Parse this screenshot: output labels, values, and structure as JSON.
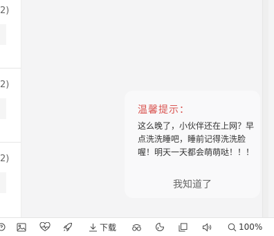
{
  "left_list": {
    "items": [
      {
        "paren": "2)"
      },
      {
        "paren": "2)"
      },
      {
        "paren": "2)"
      }
    ]
  },
  "notice": {
    "title": "温馨提示：",
    "message": "这么晚了，小伙伴还在上网？早点洗洗睡吧，睡前记得洗洗脸喔！明天一天都会萌萌哒！！！",
    "button_label": "我知道了"
  },
  "toolbar": {
    "items": [
      {
        "icon": "help-icon"
      },
      {
        "icon": "image-icon"
      },
      {
        "icon": "heartbeat-icon"
      },
      {
        "icon": "rocket-icon"
      },
      {
        "icon": "download-icon",
        "label": "下载"
      },
      {
        "icon": "vr-glasses-icon"
      },
      {
        "icon": "theme-icon"
      },
      {
        "icon": "window-icon"
      },
      {
        "icon": "volume-icon"
      },
      {
        "icon": "zoom-icon",
        "label": "100%"
      }
    ]
  }
}
